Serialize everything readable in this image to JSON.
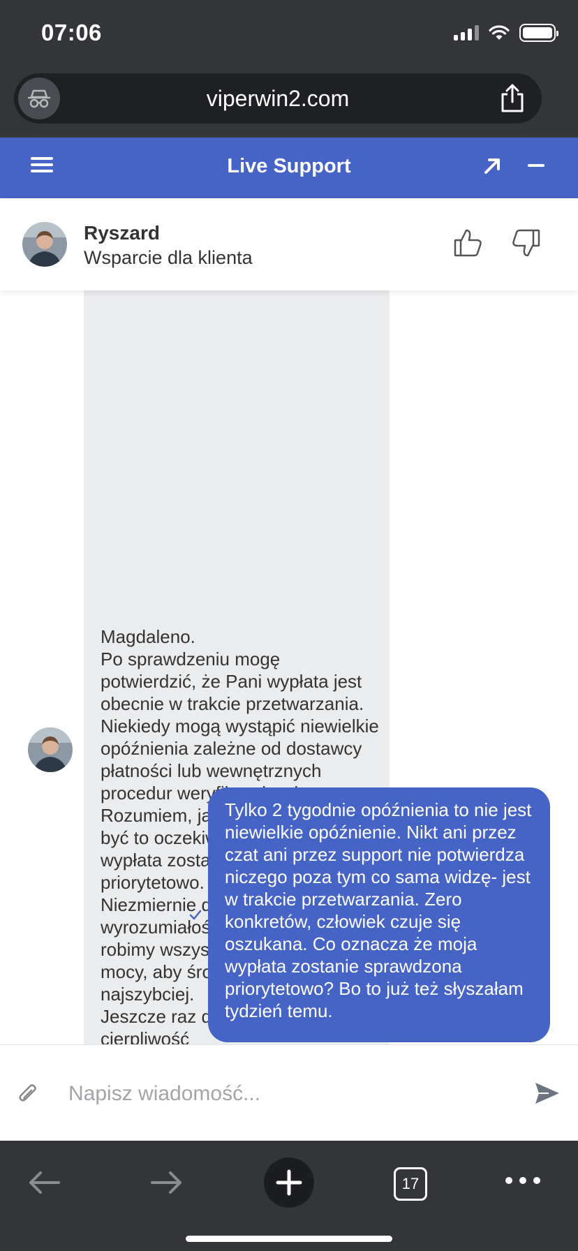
{
  "status_bar": {
    "time": "07:06"
  },
  "browser": {
    "url": "viperwin2.com",
    "tab_count": "17"
  },
  "chat": {
    "title": "Live Support",
    "agent": {
      "name": "Ryszard",
      "role": "Wsparcie dla klienta"
    },
    "messages": {
      "agent_text": "Magdaleno.\nPo sprawdzeniu mogę potwierdzić, że Pani wypłata jest obecnie w trakcie przetwarzania.\nNiekiedy mogą wystąpić niewielkie opóźnienia zależne od dostawcy płatności lub wewnętrznych procedur weryfikacyjnych. Rozumiem, jak frustrujące może być to oczekiwanie, dlatego Pani wypłata zostanie sprawdzona priorytetowo.\nNiezmiernie doceniam Pani wyrozumiałość i zapewniam, że robimy wszystko, co w naszej mocy, aby środki trafiły do Pani jak najszybciej.\nJeszcze raz dziękuję za cierpliwość",
      "user_text": "Tylko 2 tygodnie opóźnienia to nie jest niewielkie opóźnienie. Nikt ani przez czat ani przez support nie potwierdza niczego poza tym co sama widzę- jest w trakcie przetwarzania. Zero konkretów, człowiek czuje się oszukana. Co oznacza że moja wypłata zostanie sprawdzona priorytetowo? Bo to już też słyszałam tydzień temu."
    },
    "composer": {
      "placeholder": "Napisz wiadomość..."
    }
  },
  "colors": {
    "accent": "#4663c6",
    "browser_chrome": "#333539",
    "agent_bubble": "#ebecee"
  }
}
